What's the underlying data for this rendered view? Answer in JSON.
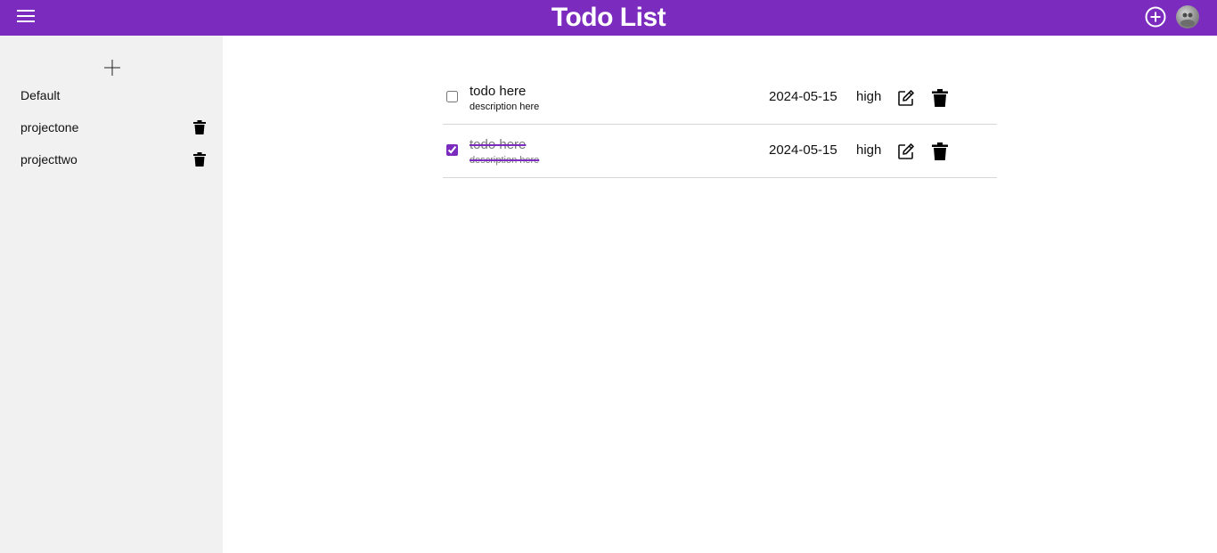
{
  "header": {
    "title": "Todo List",
    "menu_icon": "hamburger-menu-icon",
    "add_icon": "plus-circle-icon",
    "avatar_icon": "user-avatar"
  },
  "colors": {
    "brand": "#7b2cbf",
    "sidebar_bg": "#f1f1f1",
    "divider": "#d6d6d6"
  },
  "sidebar": {
    "add_icon": "plus-icon",
    "projects": [
      {
        "label": "Default",
        "deletable": false
      },
      {
        "label": "projectone",
        "deletable": true,
        "delete_icon": "trash-icon"
      },
      {
        "label": "projecttwo",
        "deletable": true,
        "delete_icon": "trash-icon"
      }
    ]
  },
  "todos": [
    {
      "title": "todo here",
      "description": "description here",
      "date": "2024-05-15",
      "priority": "high",
      "completed": false,
      "edit_icon": "edit-icon",
      "delete_icon": "trash-icon"
    },
    {
      "title": "todo here",
      "description": "description here",
      "date": "2024-05-15",
      "priority": "high",
      "completed": true,
      "edit_icon": "edit-icon",
      "delete_icon": "trash-icon"
    }
  ]
}
